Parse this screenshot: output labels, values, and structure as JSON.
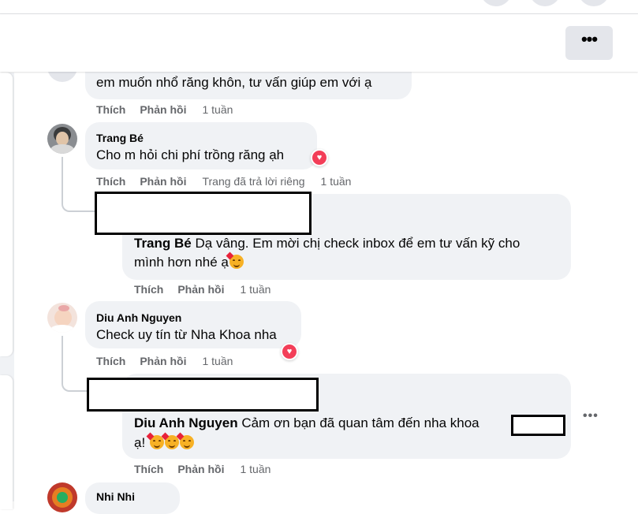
{
  "header": {
    "more_label": "•••"
  },
  "comments": [
    {
      "author": "",
      "text": "em muốn nhổ răng khôn, tư vấn giúp em với ạ",
      "like": "Thích",
      "reply": "Phản hồi",
      "time": "1 tuần"
    },
    {
      "author": "Trang Bé",
      "text": "Cho m hỏi chi phí trồng răng ạh",
      "like": "Thích",
      "reply": "Phản hồi",
      "note": "Trang đã trả lời riêng",
      "time": "1 tuần",
      "reaction": "heart-icon",
      "reply_item": {
        "mention": "Trang Bé",
        "text_line1": "Dạ vâng. Em mời chị check inbox để em tư vấn kỹ cho",
        "text_line2": "mình hơn nhé ạ",
        "like": "Thích",
        "reply": "Phản hồi",
        "time": "1 tuần"
      }
    },
    {
      "author": "Diu Anh Nguyen",
      "text": "Check uy tín từ Nha Khoa nha",
      "like": "Thích",
      "reply": "Phản hồi",
      "time": "1 tuần",
      "reaction": "heart-icon",
      "reply_item": {
        "mention": "Diu Anh Nguyen",
        "text_line1": "Cảm ơn bạn đã quan tâm đến nha khoa",
        "text_line2": "ạ!",
        "like": "Thích",
        "reply": "Phản hồi",
        "time": "1 tuần",
        "more_label": "•••"
      }
    },
    {
      "author": "Nhi Nhi"
    }
  ],
  "colors": {
    "bubble": "#f0f2f5",
    "secondary_text": "#65676b",
    "heart": "#f33e58"
  }
}
